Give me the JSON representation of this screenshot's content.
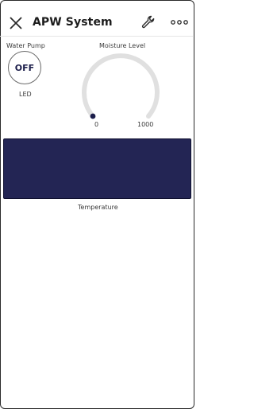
{
  "header": {
    "title": "APW System",
    "icons": {
      "close": "close-icon",
      "settings": "wrench-icon",
      "more": "more-dots-icon"
    }
  },
  "water_pump": {
    "label": "Water Pump",
    "state": "OFF",
    "led_label": "LED"
  },
  "moisture": {
    "title": "Moisture Level",
    "min": "0",
    "max": "1000",
    "value": 0
  },
  "temperature": {
    "label": "Temperature",
    "panel_color": "#232554"
  },
  "colors": {
    "accent": "#1b1d4a",
    "gauge_track": "#e0e0e0"
  }
}
